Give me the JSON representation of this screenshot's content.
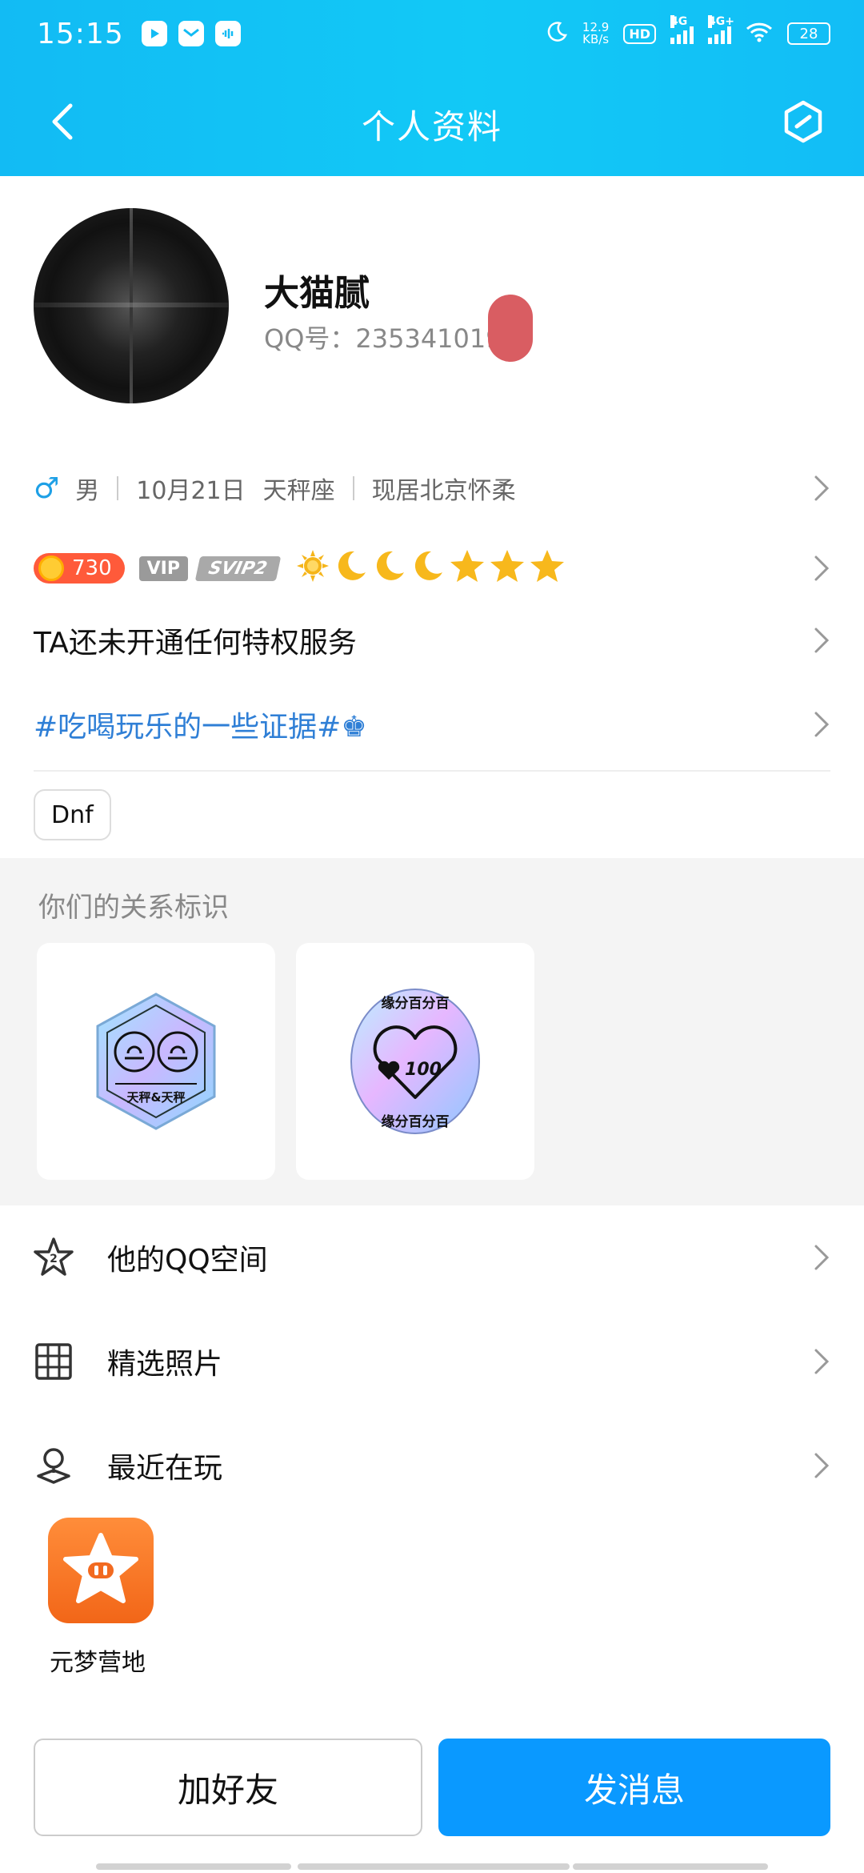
{
  "status_bar": {
    "time": "15:15",
    "net_speed_value": "12.9",
    "net_speed_unit": "KB/s",
    "hd": "HD",
    "sim1_type": "4G",
    "sim2_type": "4G+",
    "battery": "28"
  },
  "nav": {
    "title": "个人资料"
  },
  "profile": {
    "nickname": "大猫腻",
    "qq_label": "QQ号：235341019",
    "gender_symbol": "♂",
    "gender": "男",
    "birthday": "10月21日",
    "zodiac": "天秤座",
    "location": "现居北京怀柔"
  },
  "badges": {
    "level": "730",
    "vip": "VIP",
    "svip": "SVIP2",
    "level_icons": [
      "sun-icon",
      "moon-icon",
      "moon-icon",
      "moon-icon",
      "star-icon",
      "star-icon",
      "star-icon"
    ]
  },
  "privilege_text": "TA还未开通任何特权服务",
  "signature_tag": "#吃喝玩乐的一些证据#♚",
  "interest_tag": "Dnf",
  "relation": {
    "title": "你们的关系标识",
    "card1_label": "天秤&天秤",
    "card2_top": "缘分百分百",
    "card2_bottom": "缘分百分百",
    "card2_number": "100"
  },
  "menu": {
    "qzone": "他的QQ空间",
    "photos": "精选照片",
    "recent": "最近在玩"
  },
  "recent_game": {
    "name": "元梦营地"
  },
  "buttons": {
    "add_friend": "加好友",
    "send_message": "发消息"
  },
  "colors": {
    "header": "#12bbf4",
    "primary_button": "#0a99ff",
    "tag_link": "#2f7fd6",
    "level_badge": "#ff5a3a"
  }
}
